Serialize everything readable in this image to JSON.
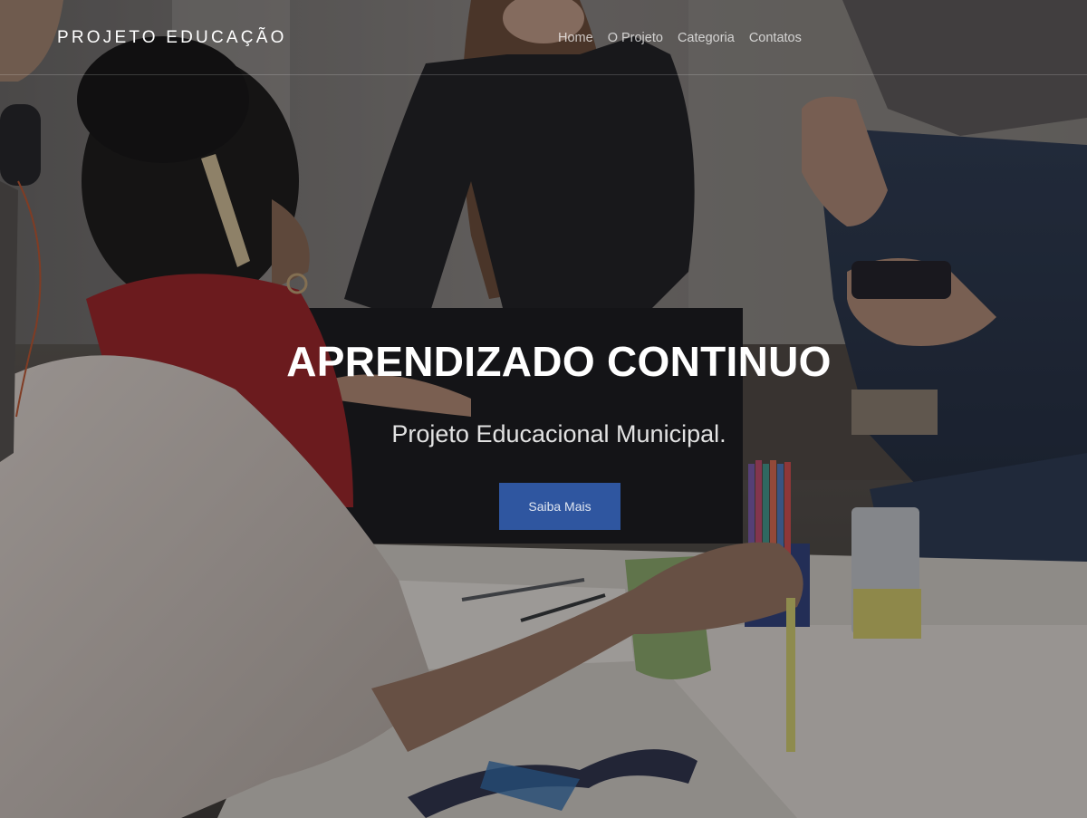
{
  "navbar": {
    "brand": "PROJETO EDUCAÇÃO",
    "links": [
      "Home",
      "O Projeto",
      "Categoria",
      "Contatos"
    ]
  },
  "hero": {
    "title": "APRENDIZADO CONTINUO",
    "subtitle": "Projeto Educacional Municipal.",
    "button_label": "Saiba Mais"
  },
  "colors": {
    "button_bg": "#2f56a0",
    "overlay": "rgba(20,20,24,0.38)"
  }
}
